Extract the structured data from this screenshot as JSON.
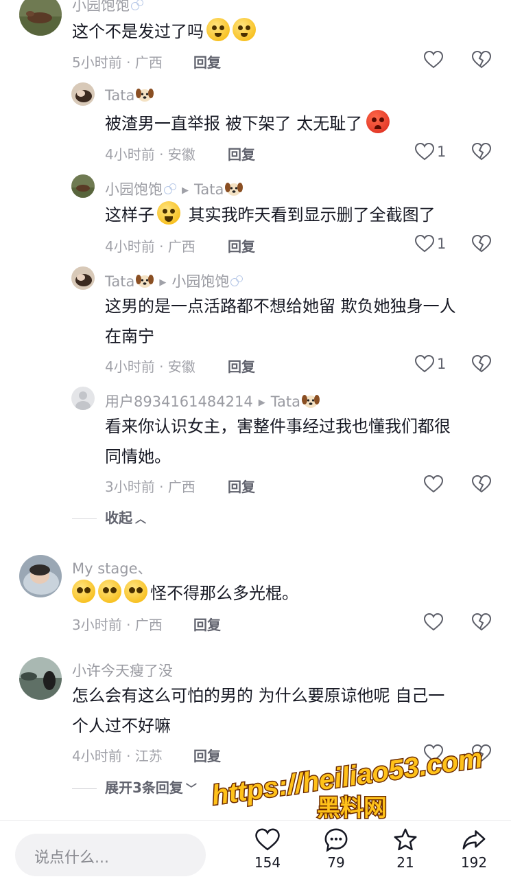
{
  "comments": [
    {
      "name": "小园饱饱",
      "text": "这个不是发过了吗",
      "meta": "5小时前 · 广西",
      "reply_label": "回复",
      "replies": [
        {
          "name": "Tata",
          "target": "",
          "text": "被渣男一直举报 被下架了 太无耻了",
          "meta": "4小时前 · 安徽",
          "reply_label": "回复",
          "likes": "1"
        },
        {
          "name": "小园饱饱",
          "target": "Tata",
          "text": "这样子",
          "text2": " 其实我昨天看到显示删了全截图了",
          "meta": "4小时前 · 广西",
          "reply_label": "回复",
          "likes": "1"
        },
        {
          "name": "Tata",
          "target": "小园饱饱",
          "text": "这男的是一点活路都不想给她留 欺负她独身一人",
          "text_line2": "在南宁",
          "meta": "4小时前 · 安徽",
          "reply_label": "回复",
          "likes": "1"
        },
        {
          "name": "用户8934161484214",
          "target": "Tata",
          "text": "看来你认识女主，害整件事经过我也懂我们都很",
          "text_line2": "同情她。",
          "meta": "3小时前 · 广西",
          "reply_label": "回复",
          "likes": ""
        }
      ],
      "collapse_label": "收起"
    },
    {
      "name": "My  stage、",
      "text": "怪不得那么多光棍。",
      "meta": "3小时前 · 广西",
      "reply_label": "回复"
    },
    {
      "name": "小许今天瘦了没",
      "text": "怎么会有这么可怕的男的 为什么要原谅他呢 自己一",
      "text_line2": "个人过不好嘛",
      "meta": "4小时前 · 江苏",
      "reply_label": "回复",
      "expand_label": "展开3条回复"
    }
  ],
  "bottom_bar": {
    "input_placeholder": "说点什么...",
    "likes": "154",
    "comments": "79",
    "favorites": "21",
    "shares": "192"
  },
  "watermark": {
    "url": "https://heiliao53.com",
    "name": "黑料网"
  },
  "colors": {
    "text_primary": "#161823",
    "text_secondary": "#a0a1a8",
    "watermark_fill": "#ffc21a",
    "watermark_stroke": "#6b2a00"
  }
}
